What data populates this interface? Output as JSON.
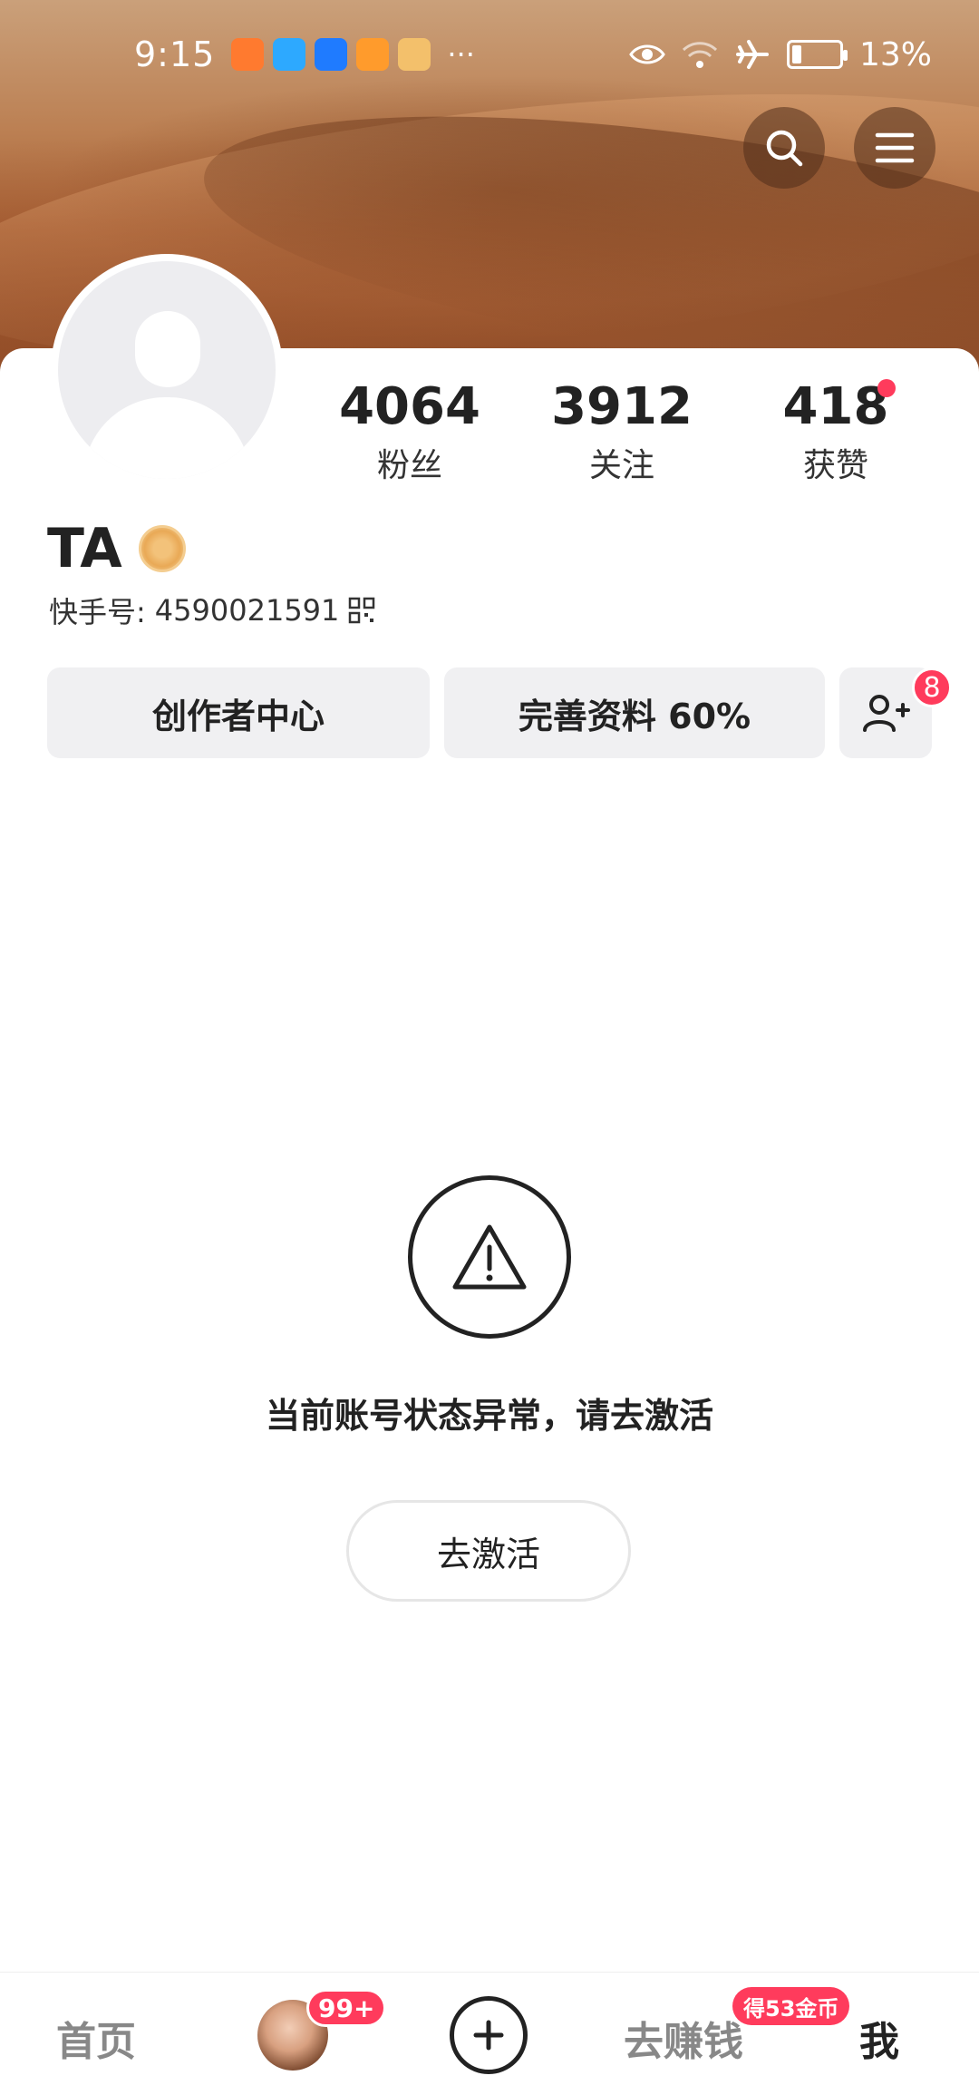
{
  "status_bar": {
    "time": "9:15",
    "more": "···",
    "battery_percent": "13%",
    "icons": [
      "eye-icon",
      "wifi-icon",
      "airplane-icon",
      "battery-icon"
    ]
  },
  "header": {
    "search_icon": "search-icon",
    "menu_icon": "menu-icon"
  },
  "profile": {
    "name": "TA",
    "kuaishou_id_label": "快手号:",
    "kuaishou_id": "4590021591",
    "stats": {
      "fans": {
        "value": "4064",
        "label": "粉丝"
      },
      "following": {
        "value": "3912",
        "label": "关注"
      },
      "likes": {
        "value": "418",
        "label": "获赞"
      }
    }
  },
  "actions": {
    "creator_center": "创作者中心",
    "complete_profile": "完善资料 60%",
    "add_friend_badge": "8"
  },
  "notice": {
    "message": "当前账号状态异常，请去激活",
    "activate_button": "去激活"
  },
  "bottom_nav": {
    "home": "首页",
    "messages_badge": "99+",
    "earn": "去赚钱",
    "earn_badge": "得53金币",
    "me": "我"
  },
  "colors": {
    "accent": "#ff3b5c",
    "button_bg": "#f0f0f2",
    "text_primary": "#222222"
  }
}
